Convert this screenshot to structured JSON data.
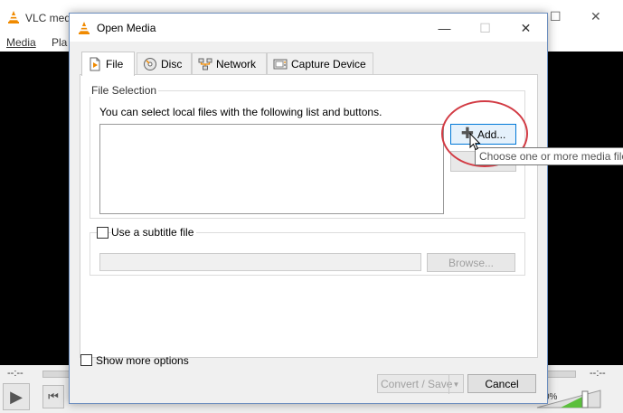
{
  "background_window": {
    "title": "VLC med",
    "menu": [
      "Media",
      "Pla"
    ],
    "time_left": "--:--",
    "time_right": "--:--",
    "volume": "0%"
  },
  "dialog": {
    "title": "Open Media",
    "tabs": [
      {
        "label": "File",
        "icon": "file-icon",
        "active": true
      },
      {
        "label": "Disc",
        "icon": "disc-icon",
        "active": false
      },
      {
        "label": "Network",
        "icon": "network-icon",
        "active": false
      },
      {
        "label": "Capture Device",
        "icon": "capture-device-icon",
        "active": false
      }
    ],
    "file_selection": {
      "legend": "File Selection",
      "instruction": "You can select local files with the following list and buttons.",
      "add_button": "Add...",
      "tooltip": "Choose one or more media file"
    },
    "subtitle": {
      "label": "Use a subtitle file",
      "browse_button": "Browse..."
    },
    "show_more_options": "Show more options",
    "convert_save_button": "Convert / Save",
    "cancel_button": "Cancel"
  },
  "colors": {
    "highlight": "#d23b44",
    "focus_border": "#0078d7",
    "dialog_border": "#6d8fbf"
  }
}
